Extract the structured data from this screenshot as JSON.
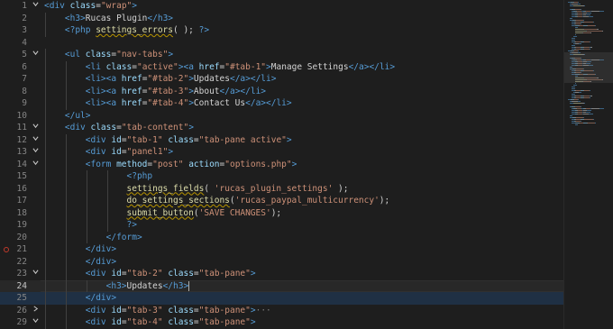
{
  "colors": {
    "background": "#1e1e1e",
    "tag": "#569cd6",
    "attribute": "#9cdcfe",
    "string": "#ce9178",
    "function": "#dcdcaa",
    "text": "#d4d4d4",
    "line_number": "#858585"
  },
  "editor": {
    "current_line": 24,
    "selected_line": 25,
    "lines": [
      {
        "n": "1",
        "fold": "v",
        "indent": 0,
        "tokens": [
          {
            "t": "tag",
            "v": "<div "
          },
          {
            "t": "attr",
            "v": "class"
          },
          {
            "t": "text",
            "v": "="
          },
          {
            "t": "str",
            "v": "\"wrap\""
          },
          {
            "t": "tag",
            "v": ">"
          }
        ]
      },
      {
        "n": "2",
        "fold": "",
        "indent": 1,
        "tokens": [
          {
            "t": "tag",
            "v": "<h3>"
          },
          {
            "t": "text",
            "v": "Rucas Plugin"
          },
          {
            "t": "tag",
            "v": "</h3>"
          }
        ]
      },
      {
        "n": "3",
        "fold": "",
        "indent": 1,
        "tokens": [
          {
            "t": "php",
            "v": "<?php "
          },
          {
            "t": "fn",
            "v": "settings_errors",
            "sq": true
          },
          {
            "t": "text",
            "v": "( ); "
          },
          {
            "t": "php",
            "v": "?>"
          }
        ]
      },
      {
        "n": "4",
        "fold": "",
        "indent": 0,
        "tokens": []
      },
      {
        "n": "5",
        "fold": "v",
        "indent": 1,
        "tokens": [
          {
            "t": "tag",
            "v": "<ul "
          },
          {
            "t": "attr",
            "v": "class"
          },
          {
            "t": "text",
            "v": "="
          },
          {
            "t": "str",
            "v": "\"nav-tabs\""
          },
          {
            "t": "tag",
            "v": ">"
          }
        ]
      },
      {
        "n": "6",
        "fold": "",
        "indent": 2,
        "tokens": [
          {
            "t": "tag",
            "v": "<li "
          },
          {
            "t": "attr",
            "v": "class"
          },
          {
            "t": "text",
            "v": "="
          },
          {
            "t": "str",
            "v": "\"active\""
          },
          {
            "t": "tag",
            "v": "><a "
          },
          {
            "t": "attr",
            "v": "href"
          },
          {
            "t": "text",
            "v": "="
          },
          {
            "t": "str",
            "v": "\"#tab-1\""
          },
          {
            "t": "tag",
            "v": ">"
          },
          {
            "t": "text",
            "v": "Manage Settings"
          },
          {
            "t": "tag",
            "v": "</a></li>"
          }
        ]
      },
      {
        "n": "7",
        "fold": "",
        "indent": 2,
        "tokens": [
          {
            "t": "tag",
            "v": "<li><a "
          },
          {
            "t": "attr",
            "v": "href"
          },
          {
            "t": "text",
            "v": "="
          },
          {
            "t": "str",
            "v": "\"#tab-2\""
          },
          {
            "t": "tag",
            "v": ">"
          },
          {
            "t": "text",
            "v": "Updates"
          },
          {
            "t": "tag",
            "v": "</a></li>"
          }
        ]
      },
      {
        "n": "8",
        "fold": "",
        "indent": 2,
        "tokens": [
          {
            "t": "tag",
            "v": "<li><a "
          },
          {
            "t": "attr",
            "v": "href"
          },
          {
            "t": "text",
            "v": "="
          },
          {
            "t": "str",
            "v": "\"#tab-3\""
          },
          {
            "t": "tag",
            "v": ">"
          },
          {
            "t": "text",
            "v": "About"
          },
          {
            "t": "tag",
            "v": "</a></li>"
          }
        ]
      },
      {
        "n": "9",
        "fold": "",
        "indent": 2,
        "tokens": [
          {
            "t": "tag",
            "v": "<li><a "
          },
          {
            "t": "attr",
            "v": "href"
          },
          {
            "t": "text",
            "v": "="
          },
          {
            "t": "str",
            "v": "\"#tab-4\""
          },
          {
            "t": "tag",
            "v": ">"
          },
          {
            "t": "text",
            "v": "Contact Us"
          },
          {
            "t": "tag",
            "v": "</a></li>"
          }
        ]
      },
      {
        "n": "10",
        "fold": "",
        "indent": 1,
        "tokens": [
          {
            "t": "tag",
            "v": "</ul>"
          }
        ]
      },
      {
        "n": "11",
        "fold": "v",
        "indent": 1,
        "tokens": [
          {
            "t": "tag",
            "v": "<div "
          },
          {
            "t": "attr",
            "v": "class"
          },
          {
            "t": "text",
            "v": "="
          },
          {
            "t": "str",
            "v": "\"tab-content\""
          },
          {
            "t": "tag",
            "v": ">"
          }
        ]
      },
      {
        "n": "12",
        "fold": "v",
        "indent": 2,
        "tokens": [
          {
            "t": "tag",
            "v": "<div "
          },
          {
            "t": "attr",
            "v": "id"
          },
          {
            "t": "text",
            "v": "="
          },
          {
            "t": "str",
            "v": "\"tab-1\" "
          },
          {
            "t": "attr",
            "v": "class"
          },
          {
            "t": "text",
            "v": "="
          },
          {
            "t": "str",
            "v": "\"tab-pane active\""
          },
          {
            "t": "tag",
            "v": ">"
          }
        ]
      },
      {
        "n": "13",
        "fold": "v",
        "indent": 2,
        "tokens": [
          {
            "t": "tag",
            "v": "<div "
          },
          {
            "t": "attr",
            "v": "id"
          },
          {
            "t": "text",
            "v": "="
          },
          {
            "t": "str",
            "v": "\"panel1\""
          },
          {
            "t": "tag",
            "v": ">"
          }
        ]
      },
      {
        "n": "14",
        "fold": "v",
        "indent": 2,
        "tokens": [
          {
            "t": "tag",
            "v": "<form "
          },
          {
            "t": "attr",
            "v": "method"
          },
          {
            "t": "text",
            "v": "="
          },
          {
            "t": "str",
            "v": "\"post\" "
          },
          {
            "t": "attr",
            "v": "action"
          },
          {
            "t": "text",
            "v": "="
          },
          {
            "t": "str",
            "v": "\"options.php\""
          },
          {
            "t": "tag",
            "v": ">"
          }
        ]
      },
      {
        "n": "15",
        "fold": "",
        "indent": 4,
        "tokens": [
          {
            "t": "php",
            "v": "<?php"
          }
        ]
      },
      {
        "n": "16",
        "fold": "",
        "indent": 4,
        "tokens": [
          {
            "t": "fn",
            "v": "settings_fields",
            "sq": true
          },
          {
            "t": "text",
            "v": "( "
          },
          {
            "t": "str",
            "v": "'rucas_plugin_settings'"
          },
          {
            "t": "text",
            "v": " );"
          }
        ]
      },
      {
        "n": "17",
        "fold": "",
        "indent": 4,
        "tokens": [
          {
            "t": "fn",
            "v": "do_settings_sections",
            "sq": true
          },
          {
            "t": "text",
            "v": "("
          },
          {
            "t": "str",
            "v": "'rucas_paypal_multicurrency'"
          },
          {
            "t": "text",
            "v": ");"
          }
        ]
      },
      {
        "n": "18",
        "fold": "",
        "indent": 4,
        "tokens": [
          {
            "t": "fn",
            "v": "submit_button",
            "sq": true
          },
          {
            "t": "text",
            "v": "("
          },
          {
            "t": "str",
            "v": "'SAVE CHANGES'"
          },
          {
            "t": "text",
            "v": ");"
          }
        ]
      },
      {
        "n": "19",
        "fold": "",
        "indent": 4,
        "tokens": [
          {
            "t": "php",
            "v": "?>"
          }
        ]
      },
      {
        "n": "20",
        "fold": "",
        "indent": 3,
        "tokens": [
          {
            "t": "tag",
            "v": "</form>"
          }
        ]
      },
      {
        "n": "21",
        "fold": "",
        "indent": 2,
        "bp": true,
        "tokens": [
          {
            "t": "tag",
            "v": "</div>"
          }
        ]
      },
      {
        "n": "22",
        "fold": "",
        "indent": 2,
        "tokens": [
          {
            "t": "tag",
            "v": "</div>"
          }
        ]
      },
      {
        "n": "23",
        "fold": "v",
        "indent": 2,
        "tokens": [
          {
            "t": "tag",
            "v": "<div "
          },
          {
            "t": "attr",
            "v": "id"
          },
          {
            "t": "text",
            "v": "="
          },
          {
            "t": "str",
            "v": "\"tab-2\" "
          },
          {
            "t": "attr",
            "v": "class"
          },
          {
            "t": "text",
            "v": "="
          },
          {
            "t": "str",
            "v": "\"tab-pane\""
          },
          {
            "t": "tag",
            "v": ">"
          }
        ]
      },
      {
        "n": "24",
        "fold": "",
        "indent": 3,
        "caret": true,
        "tokens": [
          {
            "t": "tag",
            "v": "<h3>"
          },
          {
            "t": "text",
            "v": "Updates"
          },
          {
            "t": "tag",
            "v": "</h3>"
          }
        ]
      },
      {
        "n": "25",
        "fold": "",
        "indent": 2,
        "tokens": [
          {
            "t": "tag",
            "v": "</div>"
          }
        ]
      },
      {
        "n": "26",
        "fold": ">",
        "indent": 2,
        "tokens": [
          {
            "t": "tag",
            "v": "<div "
          },
          {
            "t": "attr",
            "v": "id"
          },
          {
            "t": "text",
            "v": "="
          },
          {
            "t": "str",
            "v": "\"tab-3\" "
          },
          {
            "t": "attr",
            "v": "class"
          },
          {
            "t": "text",
            "v": "="
          },
          {
            "t": "str",
            "v": "\"tab-pane\""
          },
          {
            "t": "tag",
            "v": ">"
          },
          {
            "t": "foldtxt",
            "v": "···"
          }
        ]
      },
      {
        "n": "29",
        "fold": "v",
        "indent": 2,
        "tokens": [
          {
            "t": "tag",
            "v": "<div "
          },
          {
            "t": "attr",
            "v": "id"
          },
          {
            "t": "text",
            "v": "="
          },
          {
            "t": "str",
            "v": "\"tab-4\" "
          },
          {
            "t": "attr",
            "v": "class"
          },
          {
            "t": "text",
            "v": "="
          },
          {
            "t": "str",
            "v": "\"tab-pane\""
          },
          {
            "t": "tag",
            "v": ">"
          }
        ]
      }
    ]
  }
}
